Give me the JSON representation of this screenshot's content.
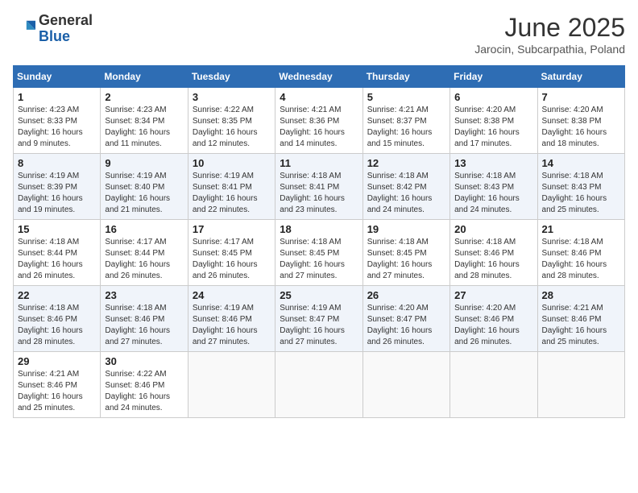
{
  "header": {
    "logo_general": "General",
    "logo_blue": "Blue",
    "month_title": "June 2025",
    "location": "Jarocin, Subcarpathia, Poland"
  },
  "days_of_week": [
    "Sunday",
    "Monday",
    "Tuesday",
    "Wednesday",
    "Thursday",
    "Friday",
    "Saturday"
  ],
  "weeks": [
    [
      {
        "day": "1",
        "sunrise": "4:23 AM",
        "sunset": "8:33 PM",
        "daylight": "16 hours and 9 minutes."
      },
      {
        "day": "2",
        "sunrise": "4:23 AM",
        "sunset": "8:34 PM",
        "daylight": "16 hours and 11 minutes."
      },
      {
        "day": "3",
        "sunrise": "4:22 AM",
        "sunset": "8:35 PM",
        "daylight": "16 hours and 12 minutes."
      },
      {
        "day": "4",
        "sunrise": "4:21 AM",
        "sunset": "8:36 PM",
        "daylight": "16 hours and 14 minutes."
      },
      {
        "day": "5",
        "sunrise": "4:21 AM",
        "sunset": "8:37 PM",
        "daylight": "16 hours and 15 minutes."
      },
      {
        "day": "6",
        "sunrise": "4:20 AM",
        "sunset": "8:38 PM",
        "daylight": "16 hours and 17 minutes."
      },
      {
        "day": "7",
        "sunrise": "4:20 AM",
        "sunset": "8:38 PM",
        "daylight": "16 hours and 18 minutes."
      }
    ],
    [
      {
        "day": "8",
        "sunrise": "4:19 AM",
        "sunset": "8:39 PM",
        "daylight": "16 hours and 19 minutes."
      },
      {
        "day": "9",
        "sunrise": "4:19 AM",
        "sunset": "8:40 PM",
        "daylight": "16 hours and 21 minutes."
      },
      {
        "day": "10",
        "sunrise": "4:19 AM",
        "sunset": "8:41 PM",
        "daylight": "16 hours and 22 minutes."
      },
      {
        "day": "11",
        "sunrise": "4:18 AM",
        "sunset": "8:41 PM",
        "daylight": "16 hours and 23 minutes."
      },
      {
        "day": "12",
        "sunrise": "4:18 AM",
        "sunset": "8:42 PM",
        "daylight": "16 hours and 24 minutes."
      },
      {
        "day": "13",
        "sunrise": "4:18 AM",
        "sunset": "8:43 PM",
        "daylight": "16 hours and 24 minutes."
      },
      {
        "day": "14",
        "sunrise": "4:18 AM",
        "sunset": "8:43 PM",
        "daylight": "16 hours and 25 minutes."
      }
    ],
    [
      {
        "day": "15",
        "sunrise": "4:18 AM",
        "sunset": "8:44 PM",
        "daylight": "16 hours and 26 minutes."
      },
      {
        "day": "16",
        "sunrise": "4:17 AM",
        "sunset": "8:44 PM",
        "daylight": "16 hours and 26 minutes."
      },
      {
        "day": "17",
        "sunrise": "4:17 AM",
        "sunset": "8:45 PM",
        "daylight": "16 hours and 26 minutes."
      },
      {
        "day": "18",
        "sunrise": "4:18 AM",
        "sunset": "8:45 PM",
        "daylight": "16 hours and 27 minutes."
      },
      {
        "day": "19",
        "sunrise": "4:18 AM",
        "sunset": "8:45 PM",
        "daylight": "16 hours and 27 minutes."
      },
      {
        "day": "20",
        "sunrise": "4:18 AM",
        "sunset": "8:46 PM",
        "daylight": "16 hours and 28 minutes."
      },
      {
        "day": "21",
        "sunrise": "4:18 AM",
        "sunset": "8:46 PM",
        "daylight": "16 hours and 28 minutes."
      }
    ],
    [
      {
        "day": "22",
        "sunrise": "4:18 AM",
        "sunset": "8:46 PM",
        "daylight": "16 hours and 28 minutes."
      },
      {
        "day": "23",
        "sunrise": "4:18 AM",
        "sunset": "8:46 PM",
        "daylight": "16 hours and 27 minutes."
      },
      {
        "day": "24",
        "sunrise": "4:19 AM",
        "sunset": "8:46 PM",
        "daylight": "16 hours and 27 minutes."
      },
      {
        "day": "25",
        "sunrise": "4:19 AM",
        "sunset": "8:47 PM",
        "daylight": "16 hours and 27 minutes."
      },
      {
        "day": "26",
        "sunrise": "4:20 AM",
        "sunset": "8:47 PM",
        "daylight": "16 hours and 26 minutes."
      },
      {
        "day": "27",
        "sunrise": "4:20 AM",
        "sunset": "8:46 PM",
        "daylight": "16 hours and 26 minutes."
      },
      {
        "day": "28",
        "sunrise": "4:21 AM",
        "sunset": "8:46 PM",
        "daylight": "16 hours and 25 minutes."
      }
    ],
    [
      {
        "day": "29",
        "sunrise": "4:21 AM",
        "sunset": "8:46 PM",
        "daylight": "16 hours and 25 minutes."
      },
      {
        "day": "30",
        "sunrise": "4:22 AM",
        "sunset": "8:46 PM",
        "daylight": "16 hours and 24 minutes."
      },
      null,
      null,
      null,
      null,
      null
    ]
  ],
  "labels": {
    "sunrise": "Sunrise:",
    "sunset": "Sunset:",
    "daylight": "Daylight:"
  }
}
